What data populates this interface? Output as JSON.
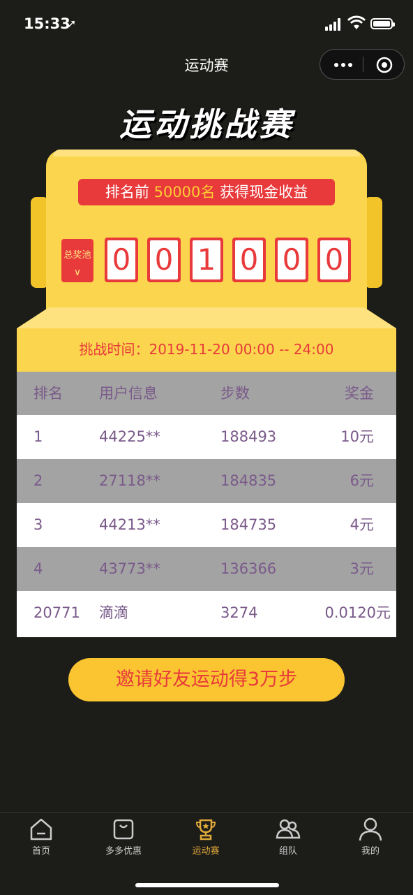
{
  "status_bar": {
    "time": "15:33",
    "location_icon": "location-arrow-icon"
  },
  "nav": {
    "title": "运动赛"
  },
  "page_title": "运动挑战赛",
  "banner": {
    "prefix": "排名前 ",
    "highlight": "50000名",
    "suffix": " 获得现金收益"
  },
  "prize_pool": {
    "label": "总奖池",
    "arrow": "∨",
    "digits": [
      "0",
      "0",
      "1",
      "0",
      "0",
      "0"
    ]
  },
  "challenge_time": "挑战时间：2019-11-20 00:00 -- 24:00",
  "table": {
    "headers": [
      "排名",
      "用户信息",
      "步数",
      "奖金"
    ],
    "rows": [
      [
        "1",
        "44225**",
        "188493",
        "10元"
      ],
      [
        "2",
        "27118**",
        "184835",
        "6元"
      ],
      [
        "3",
        "44213**",
        "184735",
        "4元"
      ],
      [
        "4",
        "43773**",
        "136366",
        "3元"
      ],
      [
        "20771",
        "滴滴",
        "3274",
        "0.0120元"
      ]
    ]
  },
  "invite_button": "邀请好友运动得3万步",
  "tabs": [
    {
      "label": "首页",
      "icon": "home-icon",
      "active": false
    },
    {
      "label": "多多优惠",
      "icon": "bag-icon",
      "active": false
    },
    {
      "label": "运动赛",
      "icon": "trophy-icon",
      "active": true
    },
    {
      "label": "组队",
      "icon": "team-icon",
      "active": false
    },
    {
      "label": "我的",
      "icon": "profile-icon",
      "active": false
    }
  ],
  "colors": {
    "background": "#1c1c19",
    "yellow": "#fbd54d",
    "red": "#e8393b",
    "active_tab": "#e0a93a",
    "table_text": "#7a5a8a"
  }
}
